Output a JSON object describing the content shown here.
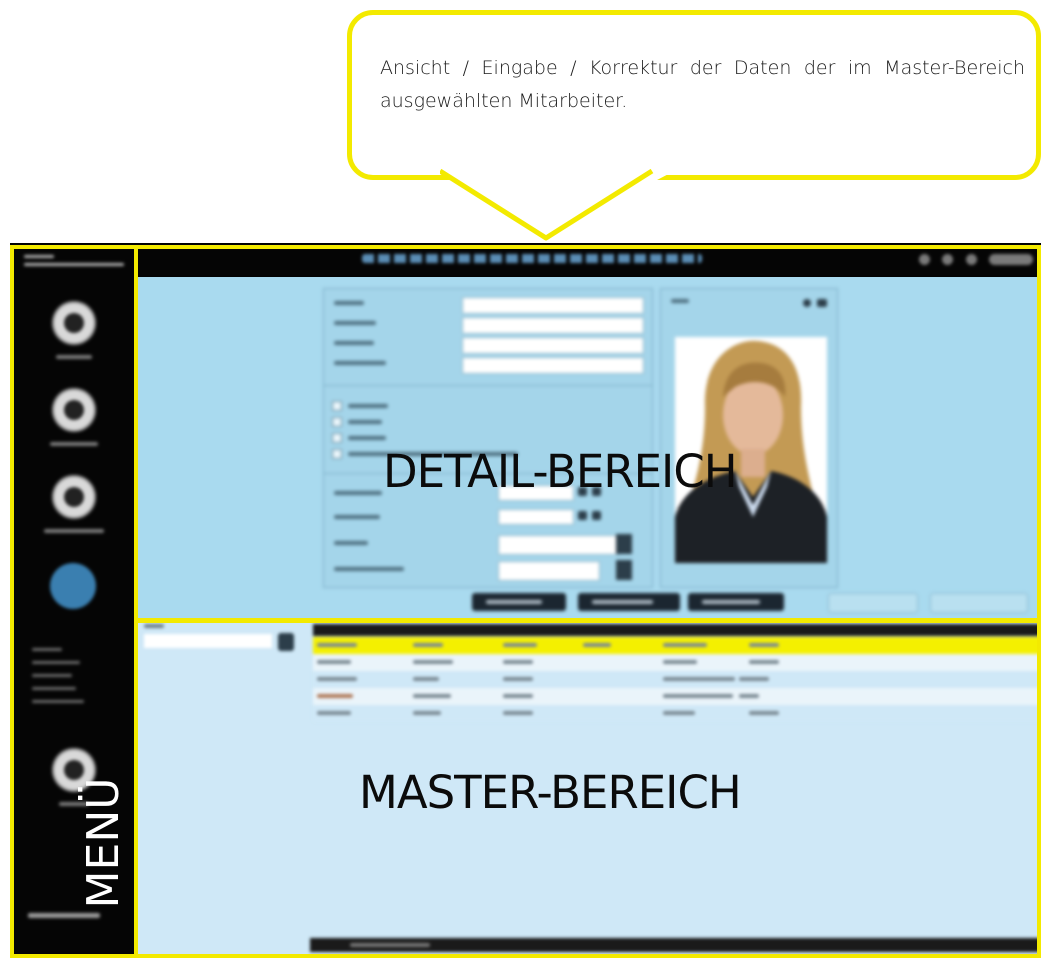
{
  "callout": {
    "text": "Ansicht / Eingabe / Korrektur der Daten der im Master-Bereich ausgewählten Mitarbeiter."
  },
  "areas": {
    "menu_label": "MENÜ",
    "detail_label": "DETAIL-BEREICH",
    "master_label": "MASTER-BEREICH"
  },
  "colors": {
    "highlight": "#f3ea00",
    "detail_background": "#a9daef",
    "master_background": "#cfe8f7",
    "selected_row": "#f4f000",
    "sidebar": "#050505"
  },
  "icons": {
    "sidebar": [
      "person-icon",
      "settings-icon",
      "warning-icon",
      "active-module-icon",
      "calendar-icon"
    ],
    "photo_tools": [
      "zoom-icon",
      "camera-icon"
    ]
  }
}
